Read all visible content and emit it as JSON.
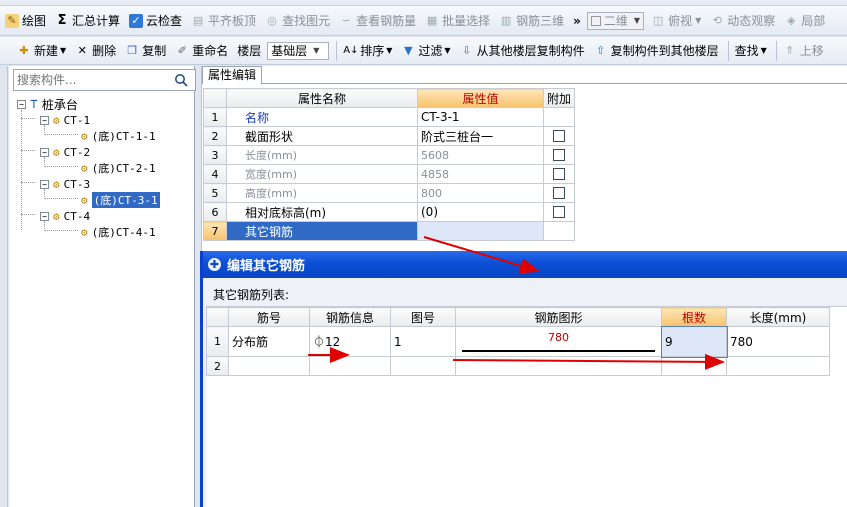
{
  "toolbar1": {
    "draw": "绘图",
    "summary_calc": "汇总计算",
    "cloud_check": "云检查",
    "flush_board": "平齐板顶",
    "find_element": "查找图元",
    "view_rebar": "查看钢筋量",
    "batch_select": "批量选择",
    "rebar_3d": "钢筋三维",
    "view_mode": "二维",
    "view_dir": "俯视",
    "dynamic_view": "动态观察",
    "local": "局部"
  },
  "toolbar2": {
    "new": "新建",
    "delete": "删除",
    "copy": "复制",
    "rename": "重命名",
    "floor_label": "楼层",
    "floor_value": "基础层",
    "sort": "排序",
    "filter": "过滤",
    "copy_from_floor": "从其他楼层复制构件",
    "copy_to_floor": "复制构件到其他楼层",
    "find": "查找",
    "move_up": "上移"
  },
  "search": {
    "placeholder": "搜索构件..."
  },
  "tree": {
    "root": "桩承台",
    "groups": [
      {
        "name": "CT-1",
        "child": "(底)CT-1-1"
      },
      {
        "name": "CT-2",
        "child": "(底)CT-2-1"
      },
      {
        "name": "CT-3",
        "child": "(底)CT-3-1"
      },
      {
        "name": "CT-4",
        "child": "(底)CT-4-1"
      }
    ]
  },
  "props": {
    "tab": "属性编辑",
    "headers": {
      "name": "属性名称",
      "value": "属性值",
      "extra": "附加"
    },
    "rows": [
      {
        "no": "1",
        "name": "名称",
        "value": "CT-3-1"
      },
      {
        "no": "2",
        "name": "截面形状",
        "value": "阶式三桩台一"
      },
      {
        "no": "3",
        "name": "长度(mm)",
        "value": "5608"
      },
      {
        "no": "4",
        "name": "宽度(mm)",
        "value": "4858"
      },
      {
        "no": "5",
        "name": "高度(mm)",
        "value": "800"
      },
      {
        "no": "6",
        "name": "相对底标高(m)",
        "value": "(0)"
      },
      {
        "no": "7",
        "name": "其它钢筋",
        "value": ""
      }
    ]
  },
  "dialog": {
    "title": "编辑其它钢筋",
    "list_label": "其它钢筋列表:",
    "headers": {
      "bar_no": "筋号",
      "bar_info": "钢筋信息",
      "fig_no": "图号",
      "shape": "钢筋图形",
      "count": "根数",
      "length": "长度(mm)"
    },
    "rows": [
      {
        "no": "1",
        "bar_no": "分布筋",
        "bar_info": "⏀12",
        "fig_no": "1",
        "shape_value": "780",
        "count": "9",
        "length": "780"
      },
      {
        "no": "2",
        "bar_no": "",
        "bar_info": "",
        "fig_no": "",
        "shape_value": "",
        "count": "",
        "length": ""
      }
    ]
  },
  "colors": {
    "accent": "#316ac5",
    "dialog_title": "#0b4fd6",
    "highlight": "#f7c26b",
    "arrow": "#e00000"
  }
}
